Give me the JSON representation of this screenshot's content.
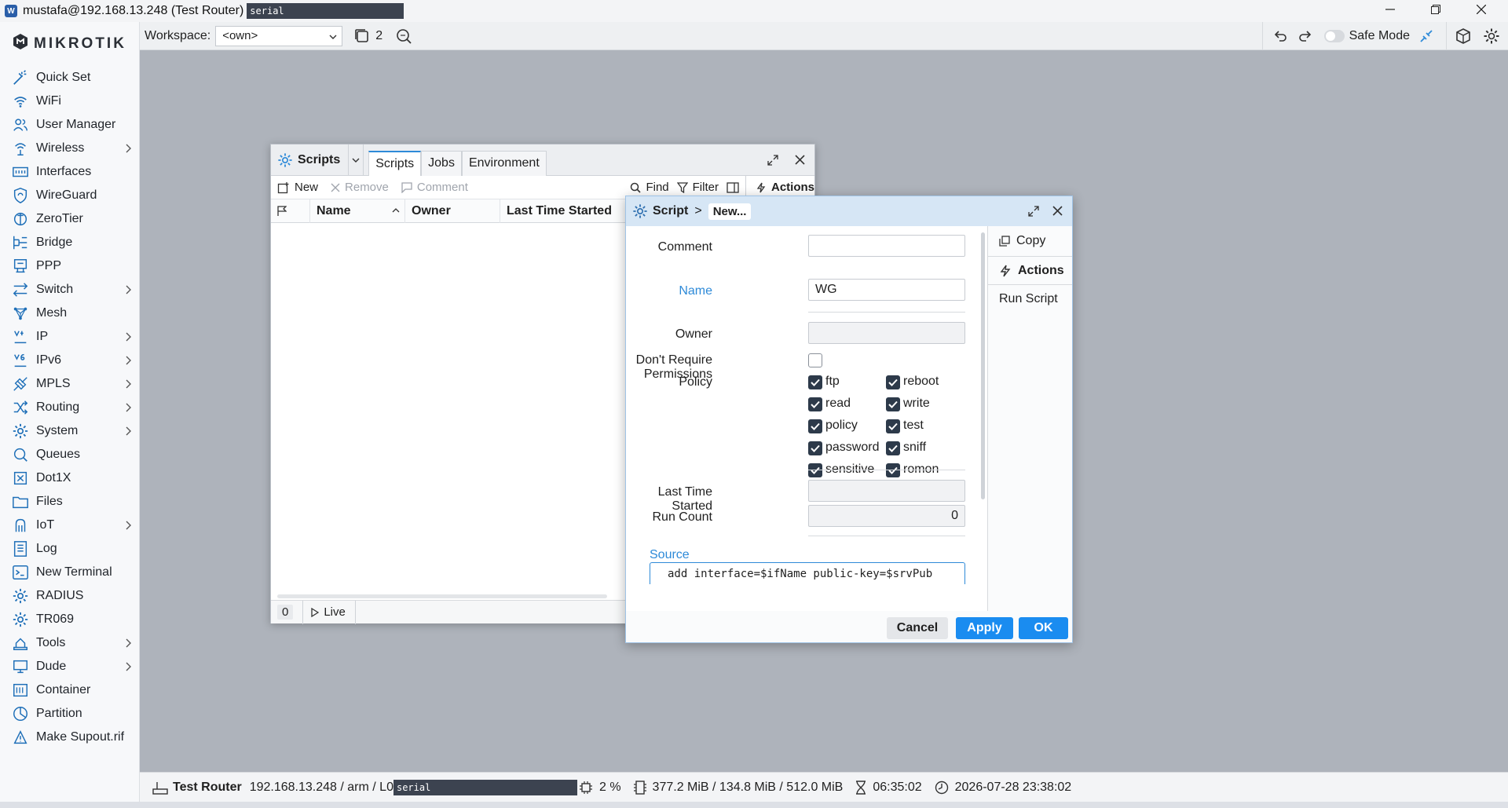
{
  "window": {
    "title": "mustafa@192.168.13.248 (Test Router)",
    "serial": "serial",
    "icon": "winbox-icon"
  },
  "toolbar": {
    "workspace_label": "Workspace:",
    "workspace_value": "<own>",
    "windows_count": "2",
    "safe_mode_label": "Safe Mode"
  },
  "sidebar": {
    "brand": "MikroTik",
    "items": [
      {
        "label": "Quick Set",
        "icon": "wand-icon",
        "submenu": false
      },
      {
        "label": "WiFi",
        "icon": "wifi-icon",
        "submenu": false
      },
      {
        "label": "User Manager",
        "icon": "users-icon",
        "submenu": false
      },
      {
        "label": "Wireless",
        "icon": "wireless-icon",
        "submenu": true
      },
      {
        "label": "Interfaces",
        "icon": "interfaces-icon",
        "submenu": false
      },
      {
        "label": "WireGuard",
        "icon": "wireguard-icon",
        "submenu": false
      },
      {
        "label": "ZeroTier",
        "icon": "zerotier-icon",
        "submenu": false
      },
      {
        "label": "Bridge",
        "icon": "bridge-icon",
        "submenu": false
      },
      {
        "label": "PPP",
        "icon": "ppp-icon",
        "submenu": false
      },
      {
        "label": "Switch",
        "icon": "switch-icon",
        "submenu": true
      },
      {
        "label": "Mesh",
        "icon": "mesh-icon",
        "submenu": false
      },
      {
        "label": "IP",
        "icon": "ip-icon",
        "submenu": true
      },
      {
        "label": "IPv6",
        "icon": "ipv6-icon",
        "submenu": true
      },
      {
        "label": "MPLS",
        "icon": "mpls-icon",
        "submenu": true
      },
      {
        "label": "Routing",
        "icon": "routing-icon",
        "submenu": true
      },
      {
        "label": "System",
        "icon": "gear-icon",
        "submenu": true
      },
      {
        "label": "Queues",
        "icon": "queues-icon",
        "submenu": false
      },
      {
        "label": "Dot1X",
        "icon": "dot1x-icon",
        "submenu": false
      },
      {
        "label": "Files",
        "icon": "folder-icon",
        "submenu": false
      },
      {
        "label": "IoT",
        "icon": "iot-icon",
        "submenu": true
      },
      {
        "label": "Log",
        "icon": "log-icon",
        "submenu": false
      },
      {
        "label": "New Terminal",
        "icon": "terminal-icon",
        "submenu": false
      },
      {
        "label": "RADIUS",
        "icon": "radius-icon",
        "submenu": false
      },
      {
        "label": "TR069",
        "icon": "tr069-icon",
        "submenu": false
      },
      {
        "label": "Tools",
        "icon": "tools-icon",
        "submenu": true
      },
      {
        "label": "Dude",
        "icon": "dude-icon",
        "submenu": true
      },
      {
        "label": "Container",
        "icon": "container-icon",
        "submenu": false
      },
      {
        "label": "Partition",
        "icon": "partition-icon",
        "submenu": false
      },
      {
        "label": "Make Supout.rif",
        "icon": "supout-icon",
        "submenu": false
      }
    ]
  },
  "scripts_window": {
    "title": "Scripts",
    "tabs": [
      "Scripts",
      "Jobs",
      "Environment"
    ],
    "toolbar": {
      "new": "New",
      "remove": "Remove",
      "comment": "Comment",
      "find": "Find",
      "filter": "Filter",
      "actions": "Actions"
    },
    "columns": [
      "Name",
      "Owner",
      "Last Time Started"
    ],
    "footer": {
      "count": "0",
      "live": "Live"
    }
  },
  "dialog": {
    "breadcrumb_root": "Script",
    "breadcrumb_sep": ">",
    "breadcrumb_current": "New...",
    "fields": {
      "comment_label": "Comment",
      "comment_value": "",
      "name_label": "Name",
      "name_value": "WG",
      "owner_label": "Owner",
      "owner_value": "",
      "dont_require_label": "Don't Require Permissions",
      "policy_label": "Policy",
      "last_started_label": "Last Time Started",
      "last_started_value": "",
      "run_count_label": "Run Count",
      "run_count_value": "0",
      "source_label": "Source",
      "source_value": "add interface=$ifName public-key=$srvPub"
    },
    "policies": [
      {
        "label": "ftp",
        "checked": true
      },
      {
        "label": "reboot",
        "checked": true
      },
      {
        "label": "read",
        "checked": true
      },
      {
        "label": "write",
        "checked": true
      },
      {
        "label": "policy",
        "checked": true
      },
      {
        "label": "test",
        "checked": true
      },
      {
        "label": "password",
        "checked": true
      },
      {
        "label": "sniff",
        "checked": true
      },
      {
        "label": "sensitive",
        "checked": true
      },
      {
        "label": "romon",
        "checked": true
      }
    ],
    "side": {
      "copy": "Copy",
      "actions": "Actions",
      "run_script": "Run Script"
    },
    "buttons": {
      "cancel": "Cancel",
      "apply": "Apply",
      "ok": "OK"
    }
  },
  "statusbar": {
    "router_name": "Test Router",
    "info": "192.168.13.248 / arm / L0",
    "serial": "serial",
    "cpu": "2 %",
    "memory": "377.2 MiB / 134.8 MiB / 512.0 MiB",
    "uptime": "06:35:02",
    "datetime": "2026-07-28 23:38:02"
  },
  "colors": {
    "accent": "#2e8ad8",
    "button_primary": "#1a8cf0",
    "sidebar_icon": "#1e6fb8",
    "desktop": "#aeb3bb"
  }
}
